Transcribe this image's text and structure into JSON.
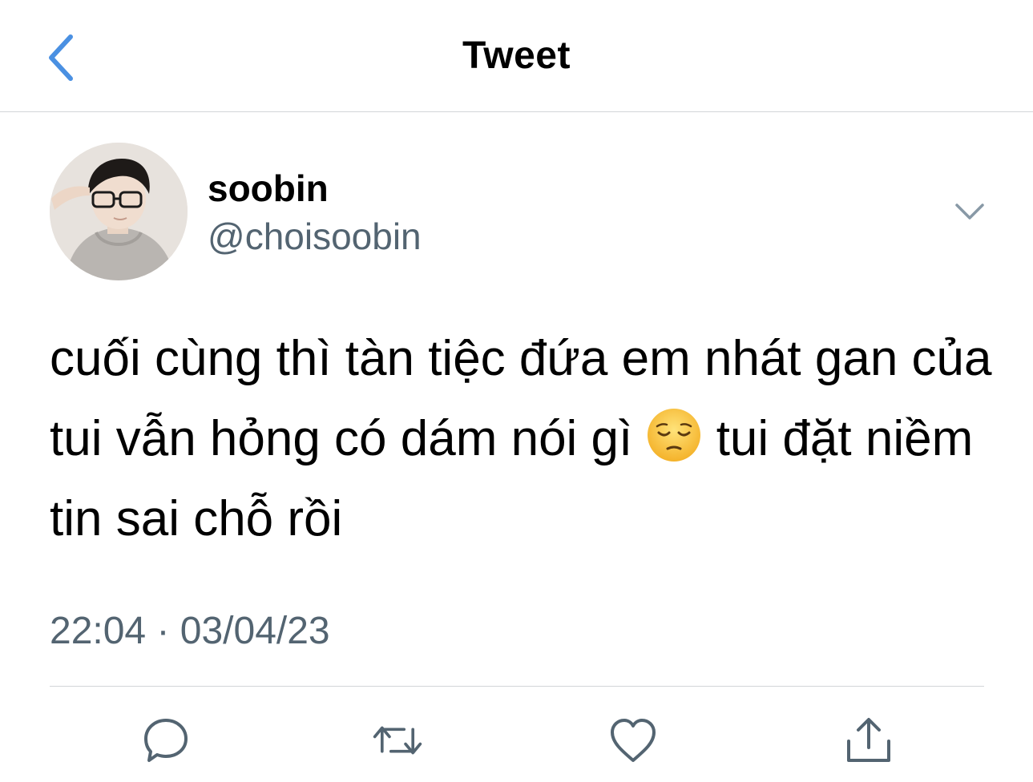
{
  "header": {
    "title": "Tweet",
    "back_icon": "chevron-left-icon"
  },
  "tweet": {
    "author": {
      "name": "soobin",
      "handle": "@choisoobin"
    },
    "text_part1": "cuối cùng thì tàn tiệc đứa em nhát gan của tui vẫn hỏng có dám nói gì ",
    "emoji": "pensive-face",
    "text_part2": " tui đặt niềm tin sai chỗ rồi",
    "timestamp": "22:04 · 03/04/23"
  },
  "actions": [
    {
      "name": "reply",
      "icon": "speech-bubble-icon"
    },
    {
      "name": "retweet",
      "icon": "retweet-icon"
    },
    {
      "name": "like",
      "icon": "heart-icon"
    },
    {
      "name": "share",
      "icon": "share-icon"
    }
  ],
  "colors": {
    "accent": "#1d9bf0",
    "back_chevron": "#4a90e2",
    "secondary_text": "#536471",
    "icon_gray": "#536471",
    "divider": "#d3d5d8"
  }
}
